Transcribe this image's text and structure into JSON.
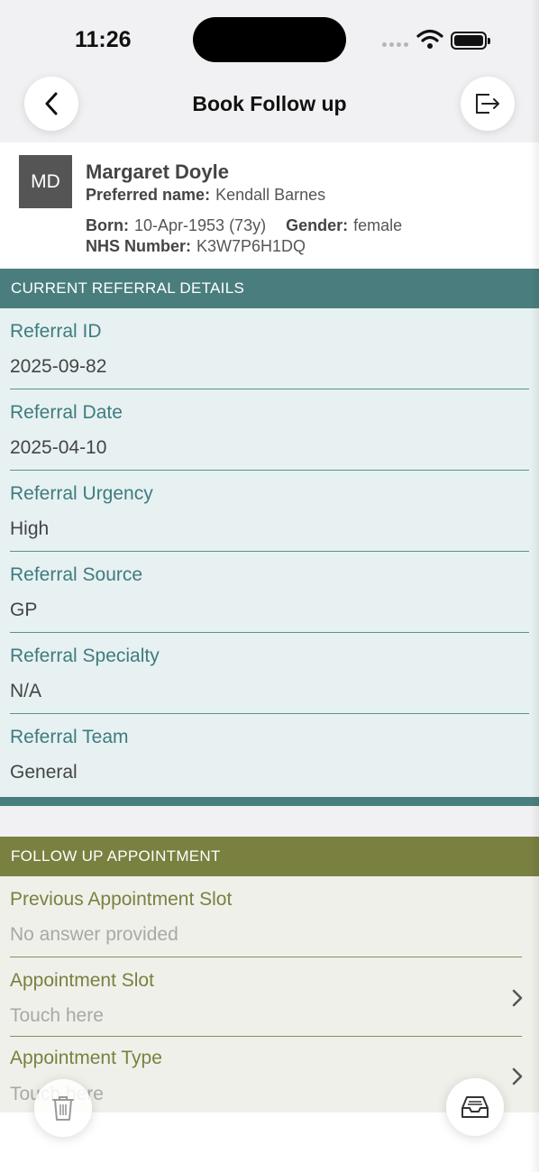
{
  "status_bar": {
    "time": "11:26"
  },
  "nav": {
    "title": "Book Follow up"
  },
  "patient": {
    "initials": "MD",
    "name": "Margaret Doyle",
    "preferred_label": "Preferred name:",
    "preferred_value": "Kendall Barnes",
    "born_label": "Born:",
    "born_value": "10-Apr-1953 (73y)",
    "gender_label": "Gender:",
    "gender_value": "female",
    "nhs_label": "NHS Number:",
    "nhs_value": "K3W7P6H1DQ"
  },
  "referral": {
    "header": "CURRENT REFERRAL DETAILS",
    "fields": [
      {
        "label": "Referral ID",
        "value": "2025-09-82"
      },
      {
        "label": "Referral Date",
        "value": "2025-04-10"
      },
      {
        "label": "Referral Urgency",
        "value": "High"
      },
      {
        "label": "Referral Source",
        "value": "GP"
      },
      {
        "label": "Referral Specialty",
        "value": "N/A"
      },
      {
        "label": "Referral Team",
        "value": "General"
      }
    ]
  },
  "followup": {
    "header": "FOLLOW UP APPOINTMENT",
    "fields": [
      {
        "label": "Previous Appointment Slot",
        "value": "No answer provided"
      },
      {
        "label": "Appointment Slot",
        "value": "Touch here"
      },
      {
        "label": "Appointment Type",
        "value": "Touch here"
      }
    ]
  },
  "colors": {
    "teal": "#4a7e7e",
    "teal_bg": "#e7f1f2",
    "olive": "#7a8040",
    "olive_bg": "#f0f0ea"
  },
  "icons": [
    "back-chevron-icon",
    "exit-icon",
    "chevron-right-icon",
    "trash-icon",
    "inbox-icon",
    "wifi-icon",
    "battery-icon"
  ]
}
